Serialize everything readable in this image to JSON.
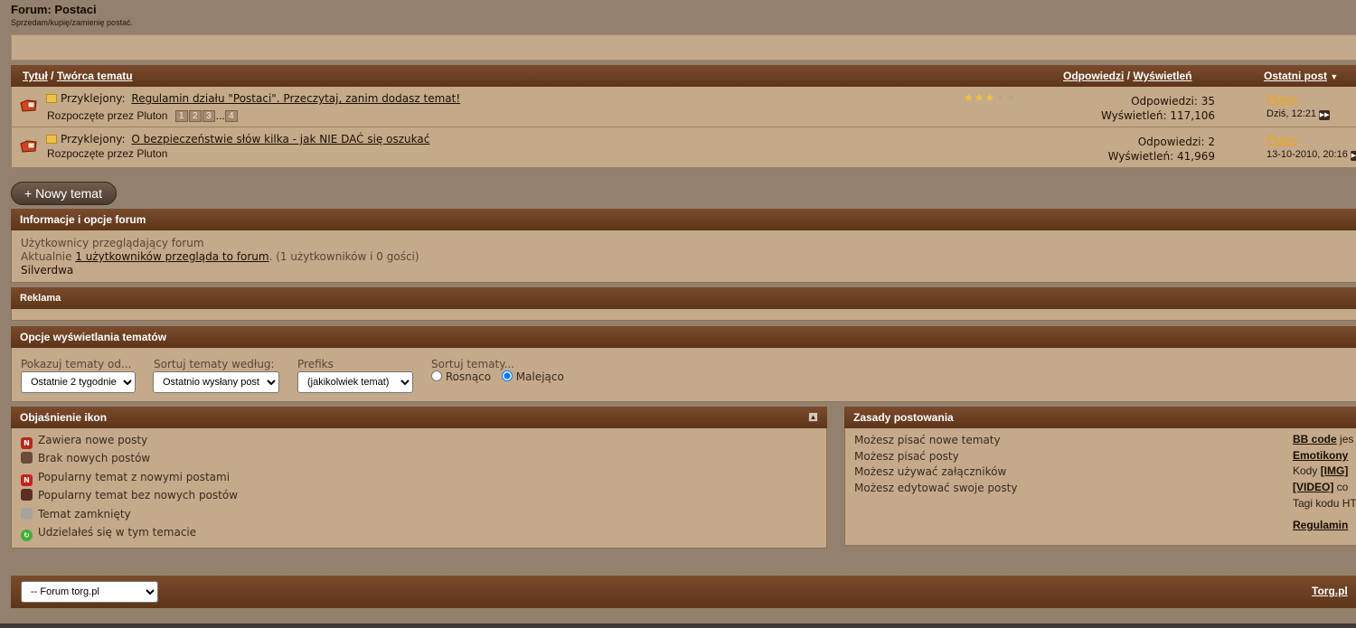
{
  "forum": {
    "title": "Forum: Postaci",
    "description": "Sprzedam/kupię/zamienię postać."
  },
  "thead": {
    "title": "Tytuł",
    "sep": "/",
    "creator": "Twórca tematu",
    "replies": "Odpowiedzi",
    "views": "Wyświetleń",
    "last_post": "Ostatni post",
    "sort_arrow": "▼"
  },
  "threads": [
    {
      "prefix": "Przyklejony:",
      "title": "Regulamin działu \"Postaci\". Przeczytaj, zanim dodasz temat!",
      "started_by": "Rozpoczęte przez Pluton",
      "pages": [
        "1",
        "2",
        "3",
        "...",
        "4"
      ],
      "rating": 3,
      "replies": "Odpowiedzi: 35",
      "views": "Wyświetleń: 117,106",
      "last_user": "Pluton",
      "last_time": "Dziś, 12:21"
    },
    {
      "prefix": "Przyklejony:",
      "title": "O bezpieczeństwie słów kilka - jak NIE DAĆ się oszukać",
      "started_by": "Rozpoczęte przez Pluton",
      "replies": "Odpowiedzi: 2",
      "views": "Wyświetleń: 41,969",
      "last_user": "Pluton",
      "last_time": "13-10-2010, 20:16"
    }
  ],
  "new_topic": "+ Nowy temat",
  "info": {
    "header": "Informacje i opcje forum",
    "viewing_label": "Użytkownicy przeglądający forum",
    "currently": "Aktualnie",
    "link": "1 użytkowników przegląda to forum",
    "counts": ". (1 użytkowników i 0 gości)",
    "user": "Silverdwa"
  },
  "ad": {
    "header": "Reklama"
  },
  "display_options": {
    "header": "Opcje wyświetlania tematów",
    "show_label": "Pokazuj tematy od...",
    "show_value": "Ostatnie 2 tygodnie",
    "sort_by_label": "Sortuj tematy według:",
    "sort_by_value": "Ostatnio wysłany post",
    "prefix_label": "Prefiks",
    "prefix_value": "(jakikolwiek temat)",
    "order_label": "Sortuj tematy...",
    "asc": "Rosnąco",
    "desc": "Malejąco"
  },
  "legend": {
    "header": "Objaśnienie ikon",
    "items": [
      "Zawiera nowe posty",
      "Brak nowych postów",
      "Popularny temat z nowymi postami",
      "Popularny temat bez nowych postów",
      "Temat zamknięty",
      "Udzielałeś się w tym temacie"
    ]
  },
  "rules": {
    "header": "Zasady postowania",
    "left": [
      "Możesz pisać nowe tematy",
      "Możesz pisać posty",
      "Możesz używać załączników",
      "Możesz edytować swoje posty"
    ],
    "bbcode": "BB code",
    "bbcode_rest": " jes",
    "emoticons": "Emotikony",
    "img_prefix": "Kody ",
    "img": "[IMG]",
    "video": "[VIDEO]",
    "video_rest": " co",
    "html": "Tagi kodu HT",
    "regulamin": "Regulamin"
  },
  "footer": {
    "select": "-- Forum torg.pl",
    "link": "Torg.pl"
  }
}
